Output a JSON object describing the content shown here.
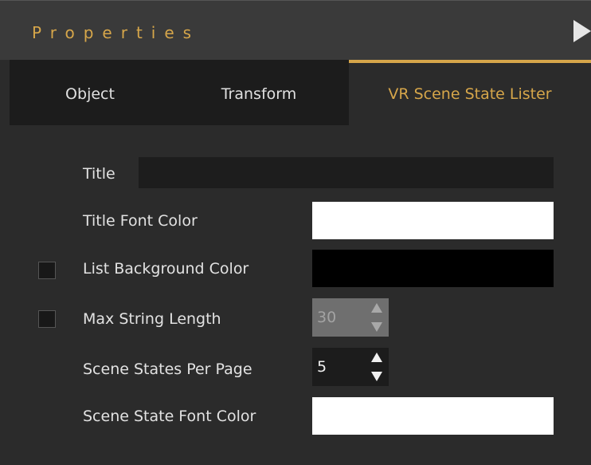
{
  "header": {
    "title": "Properties",
    "collapse_icon": "play-triangle-icon"
  },
  "tabs": [
    {
      "label": "Object"
    },
    {
      "label": "Transform"
    },
    {
      "label": "VR Scene State Lister",
      "active": true
    }
  ],
  "fields": {
    "title": {
      "label": "Title",
      "value": ""
    },
    "title_font_color": {
      "label": "Title Font Color",
      "color": "#ffffff"
    },
    "list_background_color": {
      "label": "List Background Color",
      "color": "#000000",
      "override_checked": false
    },
    "max_string_length": {
      "label": "Max String Length",
      "value": "30",
      "override_checked": false,
      "enabled": false
    },
    "scene_states_per_page": {
      "label": "Scene States Per Page",
      "value": "5",
      "enabled": true
    },
    "scene_state_font_color": {
      "label": "Scene State Font Color",
      "color": "#ffffff"
    }
  },
  "colors": {
    "accent": "#d6a64a",
    "panel_bg": "#2b2b2b",
    "tab_bg": "#1c1c1c"
  }
}
